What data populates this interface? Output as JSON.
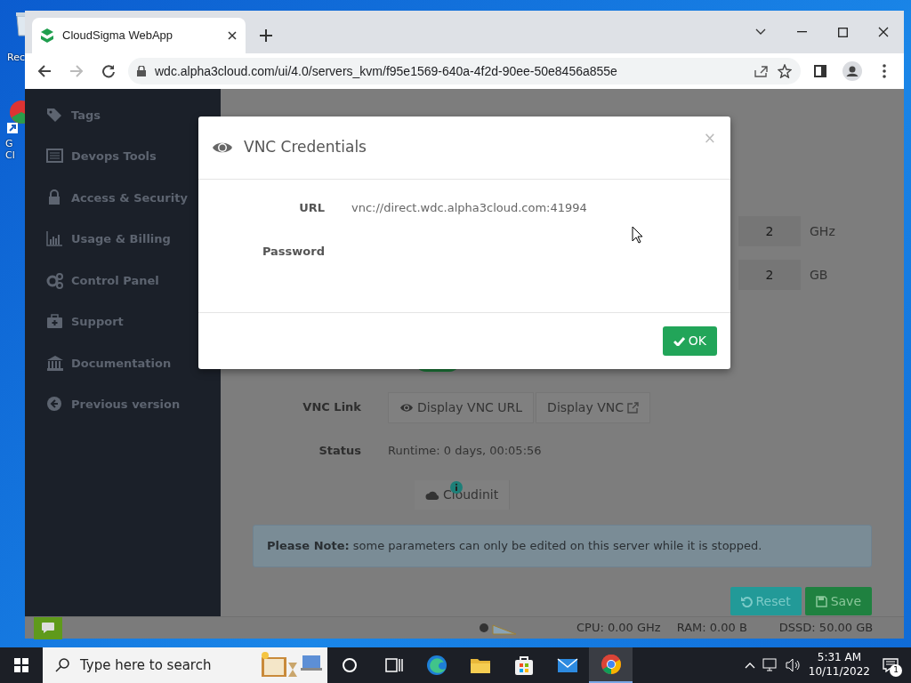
{
  "desktop_icons": [
    {
      "label": "Rec",
      "kind": "recycle"
    },
    {
      "label": "G\nCl",
      "kind": "shortcut"
    }
  ],
  "browser": {
    "tab_title": "CloudSigma WebApp",
    "url": "wdc.alpha3cloud.com/ui/4.0/servers_kvm/f95e1569-640a-4f2d-90ee-50e8456a855e"
  },
  "sidebar": {
    "items": [
      {
        "label": "Tags",
        "kind": "tags"
      },
      {
        "label": "Devops Tools",
        "kind": "list"
      },
      {
        "label": "Access & Security",
        "kind": "lock"
      },
      {
        "label": "Usage & Billing",
        "kind": "chart"
      },
      {
        "label": "Control Panel",
        "kind": "gears"
      },
      {
        "label": "Support",
        "kind": "medkit"
      },
      {
        "label": "Documentation",
        "kind": "bank"
      },
      {
        "label": "Previous version",
        "kind": "back"
      }
    ]
  },
  "server_form": {
    "cpu": {
      "value": "2",
      "unit": "GHz"
    },
    "ram": {
      "value": "2",
      "unit": "GB"
    },
    "toggle": {
      "on": true
    },
    "vnc_link": {
      "label": "VNC Link",
      "buttons": [
        "Display VNC URL",
        "Display VNC"
      ]
    },
    "status": {
      "label": "Status",
      "value": "Runtime: 0 days, 00:05:56"
    },
    "cloudinit_button": "Cloudinit",
    "note": "**Please Note:** some parameters can only be edited on this server while it is stopped.",
    "buttons": [
      "Reset",
      "Save"
    ]
  },
  "footer": {
    "cpu": "CPU: 0.00 GHz",
    "ram": "RAM: 0.00 B",
    "storage": "DSSD: 50.00 GB"
  },
  "modal": {
    "title": "VNC Credentials",
    "close": "×",
    "fields": [
      {
        "label": "URL",
        "value": "vnc://direct.wdc.alpha3cloud.com:41994"
      },
      {
        "label": "Password"
      }
    ],
    "ok_button": "OK"
  },
  "taskbar": {
    "search_placeholder": "Type here to search",
    "apps": [
      {
        "kind": "cortana",
        "selected": false
      },
      {
        "kind": "taskview",
        "selected": false
      },
      {
        "kind": "edge",
        "selected": false
      },
      {
        "kind": "folder",
        "selected": false
      },
      {
        "kind": "store",
        "selected": false
      },
      {
        "kind": "mail",
        "selected": false
      },
      {
        "kind": "chrome",
        "selected": true
      }
    ],
    "time": "5:31 AM",
    "date": "10/11/2022",
    "notification_count": "1"
  }
}
